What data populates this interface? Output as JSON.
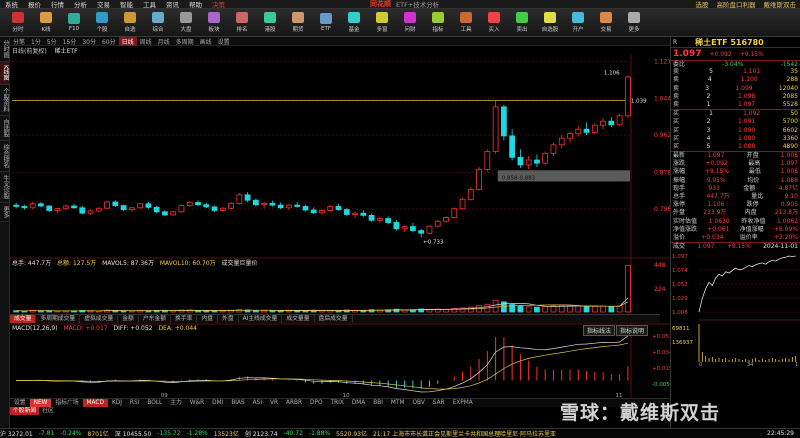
{
  "menu": {
    "items": [
      "系统",
      "报价",
      "行情",
      "分析",
      "交易",
      "智能",
      "工具",
      "资讯",
      "帮助",
      "决策"
    ],
    "brand": "同花顺",
    "subtitle": "ETF+技术分析",
    "right": [
      "选股",
      "高阶盘口利器",
      "戴维斯双击"
    ]
  },
  "toolbar": {
    "items": [
      "分时",
      "K线",
      "F10",
      "个股",
      "自选",
      "综合",
      "大盘",
      "板块",
      "排名",
      "港股",
      "期货",
      "ETF",
      "基金",
      "多窗",
      "问财",
      "指标",
      "工具",
      "买入",
      "卖出",
      "自选股",
      "开户",
      "交易",
      "更多"
    ]
  },
  "lefttabs": [
    "分时图",
    "K线图",
    "个股资料",
    "自选股",
    "综合排名",
    "牛叉诊股",
    "更多"
  ],
  "period": {
    "items": [
      "分笔",
      "1分",
      "5分",
      "15分",
      "30分",
      "60分",
      "日线",
      "周线",
      "月线",
      "多周期",
      "画线",
      "设置"
    ],
    "selected": "日线"
  },
  "chart_head": {
    "label": "日线(前复权)",
    "name": "稀土ETF"
  },
  "chart_data": [
    {
      "type": "candlestick",
      "title": "稀土ETF 516780 日线",
      "ylim": [
        0.7,
        1.13
      ],
      "yticks": [
        1.127,
        1.044,
        0.962,
        0.878,
        0.796
      ],
      "xticks": [
        "09",
        "10",
        "11"
      ],
      "annotations": [
        "1.106",
        "1.039",
        "0.733",
        "0.858-0.883"
      ],
      "ohlc": [
        [
          0.805,
          0.81,
          0.798,
          0.802
        ],
        [
          0.802,
          0.806,
          0.795,
          0.799
        ],
        [
          0.799,
          0.812,
          0.797,
          0.808
        ],
        [
          0.808,
          0.812,
          0.8,
          0.803
        ],
        [
          0.803,
          0.805,
          0.79,
          0.793
        ],
        [
          0.793,
          0.799,
          0.788,
          0.797
        ],
        [
          0.797,
          0.806,
          0.794,
          0.803
        ],
        [
          0.803,
          0.808,
          0.797,
          0.799
        ],
        [
          0.799,
          0.803,
          0.784,
          0.787
        ],
        [
          0.787,
          0.795,
          0.783,
          0.792
        ],
        [
          0.792,
          0.8,
          0.789,
          0.798
        ],
        [
          0.798,
          0.815,
          0.796,
          0.812
        ],
        [
          0.812,
          0.816,
          0.801,
          0.804
        ],
        [
          0.804,
          0.806,
          0.792,
          0.795
        ],
        [
          0.795,
          0.801,
          0.79,
          0.799
        ],
        [
          0.799,
          0.81,
          0.797,
          0.808
        ],
        [
          0.808,
          0.812,
          0.797,
          0.8
        ],
        [
          0.8,
          0.803,
          0.787,
          0.79
        ],
        [
          0.79,
          0.794,
          0.78,
          0.783
        ],
        [
          0.783,
          0.792,
          0.781,
          0.79
        ],
        [
          0.79,
          0.806,
          0.788,
          0.804
        ],
        [
          0.804,
          0.814,
          0.801,
          0.811
        ],
        [
          0.811,
          0.816,
          0.803,
          0.806
        ],
        [
          0.806,
          0.811,
          0.798,
          0.801
        ],
        [
          0.801,
          0.804,
          0.79,
          0.793
        ],
        [
          0.793,
          0.801,
          0.79,
          0.798
        ],
        [
          0.798,
          0.812,
          0.796,
          0.809
        ],
        [
          0.809,
          0.832,
          0.806,
          0.828
        ],
        [
          0.828,
          0.834,
          0.812,
          0.816
        ],
        [
          0.816,
          0.82,
          0.802,
          0.806
        ],
        [
          0.806,
          0.812,
          0.798,
          0.809
        ],
        [
          0.809,
          0.815,
          0.802,
          0.805
        ],
        [
          0.805,
          0.811,
          0.796,
          0.799
        ],
        [
          0.799,
          0.808,
          0.794,
          0.805
        ],
        [
          0.805,
          0.812,
          0.799,
          0.802
        ],
        [
          0.802,
          0.806,
          0.791,
          0.794
        ],
        [
          0.794,
          0.8,
          0.785,
          0.788
        ],
        [
          0.788,
          0.796,
          0.783,
          0.793
        ],
        [
          0.793,
          0.805,
          0.79,
          0.802
        ],
        [
          0.802,
          0.808,
          0.792,
          0.795
        ],
        [
          0.795,
          0.799,
          0.781,
          0.784
        ],
        [
          0.784,
          0.79,
          0.776,
          0.787
        ],
        [
          0.787,
          0.794,
          0.779,
          0.782
        ],
        [
          0.782,
          0.786,
          0.768,
          0.771
        ],
        [
          0.771,
          0.779,
          0.765,
          0.775
        ],
        [
          0.775,
          0.78,
          0.762,
          0.766
        ],
        [
          0.766,
          0.772,
          0.748,
          0.752
        ],
        [
          0.752,
          0.76,
          0.745,
          0.757
        ],
        [
          0.757,
          0.765,
          0.744,
          0.748
        ],
        [
          0.748,
          0.752,
          0.733,
          0.742
        ],
        [
          0.742,
          0.76,
          0.74,
          0.758
        ],
        [
          0.758,
          0.772,
          0.755,
          0.769
        ],
        [
          0.769,
          0.78,
          0.766,
          0.777
        ],
        [
          0.777,
          0.8,
          0.775,
          0.797
        ],
        [
          0.797,
          0.822,
          0.795,
          0.818
        ],
        [
          0.818,
          0.845,
          0.815,
          0.84
        ],
        [
          0.84,
          0.89,
          0.838,
          0.885
        ],
        [
          0.885,
          0.93,
          0.88,
          0.925
        ],
        [
          0.925,
          1.039,
          0.92,
          1.025
        ],
        [
          1.025,
          1.03,
          0.95,
          0.96
        ],
        [
          0.96,
          0.975,
          0.905,
          0.912
        ],
        [
          0.912,
          0.93,
          0.888,
          0.895
        ],
        [
          0.895,
          0.915,
          0.886,
          0.906
        ],
        [
          0.906,
          0.918,
          0.89,
          0.899
        ],
        [
          0.899,
          0.925,
          0.896,
          0.921
        ],
        [
          0.921,
          0.945,
          0.915,
          0.94
        ],
        [
          0.94,
          0.962,
          0.932,
          0.955
        ],
        [
          0.955,
          0.97,
          0.945,
          0.965
        ],
        [
          0.965,
          0.982,
          0.958,
          0.975
        ],
        [
          0.975,
          0.99,
          0.962,
          0.968
        ],
        [
          0.968,
          0.988,
          0.964,
          0.984
        ],
        [
          0.984,
          1.0,
          0.975,
          0.993
        ],
        [
          0.993,
          1.002,
          0.98,
          0.985
        ],
        [
          0.985,
          1.01,
          0.981,
          1.005
        ],
        [
          1.005,
          1.096,
          1.0,
          1.092
        ]
      ],
      "volume_ylim": [
        0,
        448
      ],
      "volume_yticks": [
        448,
        224
      ],
      "volume": [
        12,
        10,
        14,
        11,
        13,
        9,
        10,
        11,
        15,
        12,
        10,
        18,
        14,
        11,
        9,
        12,
        13,
        15,
        16,
        11,
        18,
        20,
        14,
        12,
        15,
        10,
        17,
        24,
        19,
        14,
        12,
        13,
        14,
        11,
        12,
        15,
        17,
        12,
        14,
        13,
        18,
        15,
        16,
        21,
        17,
        20,
        26,
        19,
        22,
        28,
        24,
        27,
        25,
        33,
        38,
        45,
        60,
        72,
        110,
        95,
        70,
        55,
        48,
        45,
        52,
        58,
        62,
        57,
        55,
        50,
        54,
        56,
        49,
        58,
        435
      ]
    }
  ],
  "vol_head": {
    "a": "总手: 447.7万",
    "b": "总额: 127.5万",
    "c": "MAVOL5: 87.36万",
    "d": "MAVOL10: 60.70万",
    "e": "成交量巨量价"
  },
  "ind_tabs": [
    "成交量",
    "多周期成交量",
    "虚拟成交量",
    "金额",
    "户东金额",
    "换手率",
    "内盘",
    "外盘",
    "AI主线成交量",
    "成交量量",
    "盘后成交量"
  ],
  "macd_head": {
    "name": "MACD(12,26,9)",
    "macd": "MACD: +0.017",
    "diff": "DIFF: +0.052",
    "dea": "DEA: +0.044",
    "btn1": "指标线法",
    "btn2": "指标说明",
    "yticks": [
      "+0.053",
      "+0.034",
      "+0.015",
      "-0.005"
    ]
  },
  "bottom_ind": [
    "设置",
    "NEW",
    "指标广场",
    "MACD",
    "KDJ",
    "RSI",
    "BOLL",
    "主力",
    "W&R",
    "DMI",
    "BIAS",
    "ASI",
    "VR",
    "ARBR",
    "DPO",
    "TRIX",
    "DMA",
    "BBI",
    "MTM",
    "OBV",
    "SAR",
    "EXPMA"
  ],
  "small_tabs": [
    "个股新闻",
    "社区"
  ],
  "status": {
    "sh": "沪 3272.01",
    "sh_chg": "-7.81",
    "sh_pct": "-0.24%",
    "sh_amt": "8701亿",
    "sz": "深 10455.50",
    "sz_chg": "-135.72",
    "sz_pct": "-1.28%",
    "sz_amt": "13523亿",
    "cy": "创 2123.74",
    "cy_chg": "-40.72",
    "cy_pct": "-1.88%",
    "cy_amt": "5520.93亿",
    "news": "21:17 上海市市长龚正会见斯里兰卡共和国总理哈里尼·阿马拉苏里亚",
    "time": "22:45:29"
  },
  "quote": {
    "title": "稀土ETF 516780",
    "price": "1.097",
    "change": "+0.092",
    "pct": "+9.15%",
    "weibi": "-3.04%",
    "weicha": "-1542",
    "sell": [
      [
        "5",
        "1.101",
        "35"
      ],
      [
        "4",
        "1.100",
        "288"
      ],
      [
        "3",
        "1.099",
        "12040"
      ],
      [
        "2",
        "1.098",
        "2085"
      ],
      [
        "1",
        "1.097",
        "5528"
      ]
    ],
    "buy": [
      [
        "1",
        "1.092",
        "50"
      ],
      [
        "2",
        "1.091",
        "5700"
      ],
      [
        "3",
        "1.090",
        "6602"
      ],
      [
        "4",
        "1.089",
        "3360"
      ],
      [
        "5",
        "1.088",
        "4890"
      ]
    ],
    "stats": [
      [
        "最新",
        "1.097",
        "开盘",
        "1.008"
      ],
      [
        "涨跌",
        "+0.092",
        "最高",
        "1.097"
      ],
      [
        "涨幅",
        "+9.15%",
        "最低",
        "1.008"
      ],
      [
        "振幅",
        "9.95%",
        "均价",
        "1.088"
      ],
      [
        "现手",
        "933",
        "金额",
        "4.87亿"
      ],
      [
        "总手",
        "447.7万",
        "量比",
        "9.10"
      ],
      [
        "涨停",
        "1.106",
        "跌停",
        "0.905"
      ],
      [
        "外盘",
        "233.9万",
        "内盘",
        "213.8万"
      ],
      [
        "实时估值",
        "1.0630",
        "昨收净值",
        "1.0062"
      ],
      [
        "净值涨跌",
        "+0.061",
        "净值涨幅",
        "+6.09%"
      ],
      [
        "溢价",
        "+0.034",
        "溢价率",
        "+3.20%"
      ]
    ],
    "mini_head": {
      "a": "成交",
      "b": "1.097",
      "c": "+9.15%",
      "date": "2024-11-01"
    },
    "mini_yticks": [
      "1.097",
      "1.074",
      "1.052",
      "1.029",
      "1.008"
    ],
    "mini_vol": [
      "69811",
      "136937"
    ],
    "mini_vol_labels": [
      "0",
      "34",
      "1"
    ]
  },
  "mini_chart": {
    "price": [
      1.008,
      1.03,
      1.045,
      1.055,
      1.05,
      1.062,
      1.068,
      1.065,
      1.072,
      1.07,
      1.074,
      1.078,
      1.075,
      1.076,
      1.079,
      1.082,
      1.08,
      1.083,
      1.085,
      1.086,
      1.084,
      1.088,
      1.09,
      1.089,
      1.092,
      1.094,
      1.095,
      1.097,
      1.096,
      1.097
    ]
  },
  "watermark": "雪球：戴维斯双击"
}
